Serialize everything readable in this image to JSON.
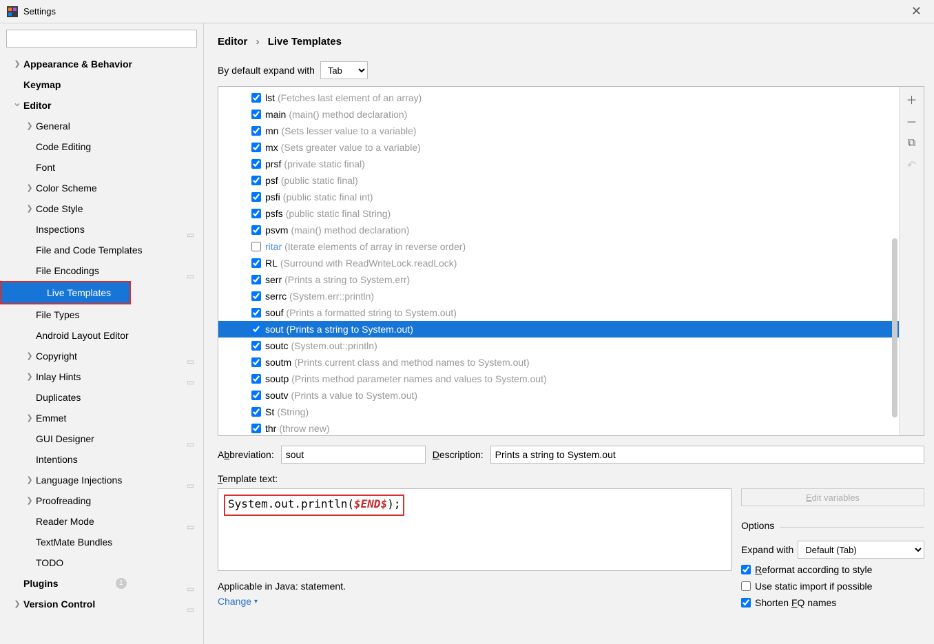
{
  "window": {
    "title": "Settings"
  },
  "sidebar": {
    "items": [
      {
        "label": "Appearance & Behavior",
        "lvl": 0,
        "chev": "right",
        "bold": true
      },
      {
        "label": "Keymap",
        "lvl": 0,
        "chev": "none",
        "bold": true
      },
      {
        "label": "Editor",
        "lvl": 0,
        "chev": "down",
        "bold": true
      },
      {
        "label": "General",
        "lvl": 1,
        "chev": "right"
      },
      {
        "label": "Code Editing",
        "lvl": 1,
        "chev": "none"
      },
      {
        "label": "Font",
        "lvl": 1,
        "chev": "none"
      },
      {
        "label": "Color Scheme",
        "lvl": 1,
        "chev": "right"
      },
      {
        "label": "Code Style",
        "lvl": 1,
        "chev": "right"
      },
      {
        "label": "Inspections",
        "lvl": 1,
        "chev": "none",
        "badge": "mod"
      },
      {
        "label": "File and Code Templates",
        "lvl": 1,
        "chev": "none"
      },
      {
        "label": "File Encodings",
        "lvl": 1,
        "chev": "none",
        "badge": "mod"
      },
      {
        "label": "Live Templates",
        "lvl": 1,
        "chev": "none",
        "selected": true,
        "hl": true
      },
      {
        "label": "File Types",
        "lvl": 1,
        "chev": "none"
      },
      {
        "label": "Android Layout Editor",
        "lvl": 1,
        "chev": "none"
      },
      {
        "label": "Copyright",
        "lvl": 1,
        "chev": "right",
        "badge": "mod"
      },
      {
        "label": "Inlay Hints",
        "lvl": 1,
        "chev": "right",
        "badge": "mod"
      },
      {
        "label": "Duplicates",
        "lvl": 1,
        "chev": "none"
      },
      {
        "label": "Emmet",
        "lvl": 1,
        "chev": "right"
      },
      {
        "label": "GUI Designer",
        "lvl": 1,
        "chev": "none",
        "badge": "mod"
      },
      {
        "label": "Intentions",
        "lvl": 1,
        "chev": "none"
      },
      {
        "label": "Language Injections",
        "lvl": 1,
        "chev": "right",
        "badge": "mod"
      },
      {
        "label": "Proofreading",
        "lvl": 1,
        "chev": "right"
      },
      {
        "label": "Reader Mode",
        "lvl": 1,
        "chev": "none",
        "badge": "mod"
      },
      {
        "label": "TextMate Bundles",
        "lvl": 1,
        "chev": "none"
      },
      {
        "label": "TODO",
        "lvl": 1,
        "chev": "none"
      },
      {
        "label": "Plugins",
        "lvl": 0,
        "chev": "none",
        "bold": true,
        "count": "1",
        "badge": "mod"
      },
      {
        "label": "Version Control",
        "lvl": 0,
        "chev": "right",
        "bold": true,
        "badge": "mod"
      }
    ]
  },
  "breadcrumb": {
    "a": "Editor",
    "b": "Live Templates"
  },
  "expand": {
    "label": "By default expand with",
    "value": "Tab"
  },
  "templates": [
    {
      "abbr": "lst",
      "desc": "(Fetches last element of an array)",
      "checked": true
    },
    {
      "abbr": "main",
      "desc": "(main() method declaration)",
      "checked": true
    },
    {
      "abbr": "mn",
      "desc": "(Sets lesser value to a variable)",
      "checked": true
    },
    {
      "abbr": "mx",
      "desc": "(Sets greater value to a variable)",
      "checked": true
    },
    {
      "abbr": "prsf",
      "desc": "(private static final)",
      "checked": true
    },
    {
      "abbr": "psf",
      "desc": "(public static final)",
      "checked": true
    },
    {
      "abbr": "psfi",
      "desc": "(public static final int)",
      "checked": true
    },
    {
      "abbr": "psfs",
      "desc": "(public static final String)",
      "checked": true
    },
    {
      "abbr": "psvm",
      "desc": "(main() method declaration)",
      "checked": true
    },
    {
      "abbr": "ritar",
      "desc": "(Iterate elements of array in reverse order)",
      "checked": false
    },
    {
      "abbr": "RL",
      "desc": "(Surround with ReadWriteLock.readLock)",
      "checked": true
    },
    {
      "abbr": "serr",
      "desc": "(Prints a string to System.err)",
      "checked": true
    },
    {
      "abbr": "serrc",
      "desc": "(System.err::println)",
      "checked": true
    },
    {
      "abbr": "souf",
      "desc": "(Prints a formatted string to System.out)",
      "checked": true
    },
    {
      "abbr": "sout",
      "desc": "(Prints a string to System.out)",
      "checked": true,
      "selected": true
    },
    {
      "abbr": "soutc",
      "desc": "(System.out::println)",
      "checked": true
    },
    {
      "abbr": "soutm",
      "desc": "(Prints current class and method names to System.out)",
      "checked": true
    },
    {
      "abbr": "soutp",
      "desc": "(Prints method parameter names and values to System.out)",
      "checked": true
    },
    {
      "abbr": "soutv",
      "desc": "(Prints a value to System.out)",
      "checked": true
    },
    {
      "abbr": "St",
      "desc": "(String)",
      "checked": true
    },
    {
      "abbr": "thr",
      "desc": "(throw new)",
      "checked": true
    }
  ],
  "detail": {
    "abbr_label": "Abbreviation:",
    "abbr_value": "sout",
    "desc_label": "Description:",
    "desc_value": "Prints a string to System.out",
    "template_text_label": "Template text:",
    "template_text_pre": "System.out.println(",
    "template_text_var": "$END$",
    "template_text_post": ");",
    "applicable": "Applicable in Java: statement.",
    "change": "Change",
    "edit_vars": "Edit variables"
  },
  "options": {
    "title": "Options",
    "expand_label": "Expand with",
    "expand_value": "Default (Tab)",
    "reformat": "Reformat according to style",
    "static_import": "Use static import if possible",
    "shorten": "Shorten FQ names"
  }
}
